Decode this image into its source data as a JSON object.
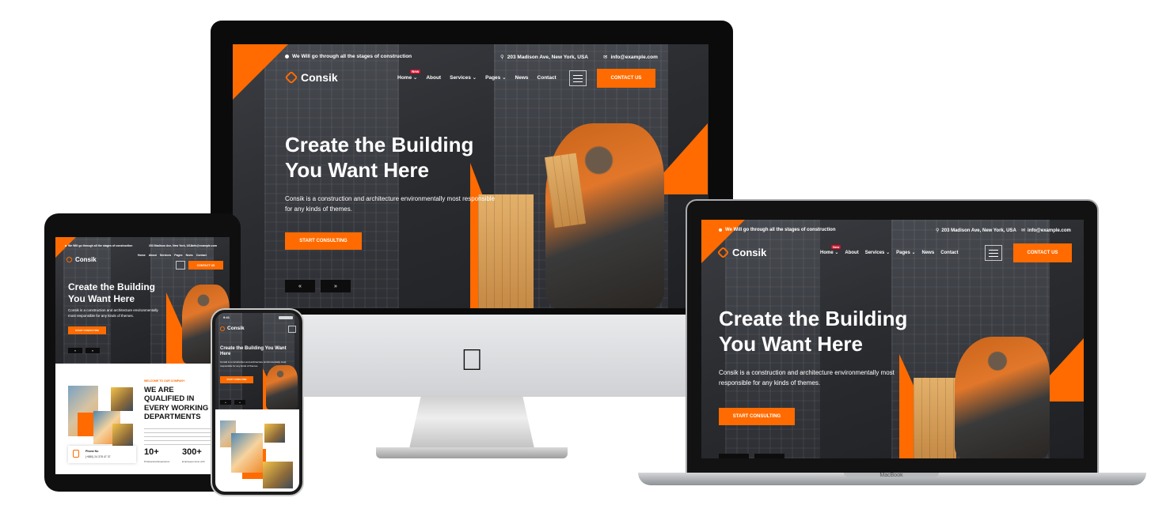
{
  "site": {
    "topbar_tagline": "We Will go through all the stages of construction",
    "address": "203 Madison Ave, New York, USA",
    "email": "info@example.com",
    "logo_text": "Consik",
    "nav": {
      "home": "Home",
      "new_badge": "New",
      "about": "About",
      "services": "Services",
      "pages": "Pages",
      "news": "News",
      "contact": "Contact"
    },
    "contact_button": "CONTACT US",
    "hero_title_line1": "Create the Building",
    "hero_title_line2": "You Want Here",
    "hero_text": "Consik is a construction and architecture environmentally most responsible for any kinds of themes.",
    "hero_text_line1": "Consik is a construction and architecture environmentally most",
    "hero_text_line2": "responsible for any kinds of themes.",
    "cta_button": "START CONSULTING",
    "prev_arrow": "«",
    "next_arrow": "»"
  },
  "ipad_section": {
    "eyebrow": "WELCOME TO OUR COMPANY",
    "heading_line1": "WE ARE",
    "heading_line2": "QUALIFIED IN",
    "heading_line3": "EVERY WORKING",
    "heading_line4": "DEPARTMENTS",
    "phone_label": "Phone No",
    "phone_value": "(+880) 24 378 47 37",
    "stat1_value": "10+",
    "stat1_label": "Professional Experience",
    "stat2_value": "300+",
    "stat2_label": "Employees done with"
  },
  "iphone_status": {
    "time": "9:41"
  },
  "devices": {
    "macbook_label": "MacBook"
  },
  "colors": {
    "accent": "#ff6b00",
    "badge": "#e0102e",
    "dark": "#2a2c30"
  }
}
